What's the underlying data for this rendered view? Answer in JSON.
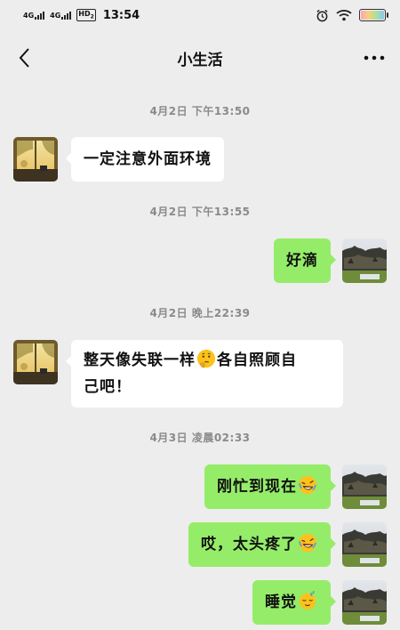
{
  "status_bar": {
    "net1": "4G",
    "net2": "4G",
    "hd": "HD",
    "hd_sub": "2",
    "time": "13:54"
  },
  "header": {
    "title": "小生活"
  },
  "messages": [
    {
      "timestamp": "4月2日 下午13:50",
      "side": "left",
      "text": "一定注意外面环境"
    },
    {
      "timestamp": "4月2日 下午13:55",
      "side": "right",
      "text": "好滴"
    },
    {
      "timestamp": "4月2日 晚上22:39",
      "side": "left",
      "text_before": "整天像失联一样",
      "emoji": "thinking-face-emoji",
      "text_after": "各自照顾自",
      "text_line2": "己吧！"
    },
    {
      "timestamp": "4月3日 凌晨02:33",
      "side": "right",
      "text": "刚忙到现在",
      "emoji": "rolling-laugh-emoji"
    },
    {
      "side": "right",
      "text": "哎，太头疼了",
      "emoji": "rolling-laugh-emoji"
    },
    {
      "side": "right",
      "text": "睡觉",
      "emoji": "sleeping-face-emoji"
    }
  ],
  "colors": {
    "background": "#ededed",
    "bubble_self": "#95ec69",
    "bubble_other": "#ffffff",
    "timestamp": "#8a8a8a"
  }
}
